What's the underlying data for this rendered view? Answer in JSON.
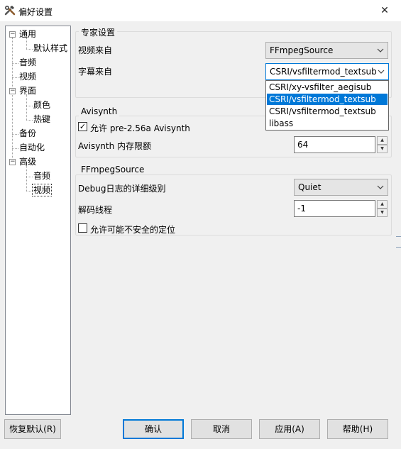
{
  "window": {
    "title": "偏好设置",
    "close_glyph": "✕"
  },
  "tree": {
    "general": "通用",
    "default_styles": "默认样式",
    "audio": "音频",
    "video": "视频",
    "interface": "界面",
    "colors": "颜色",
    "hotkeys": "热键",
    "backup": "备份",
    "automation": "自动化",
    "advanced": "高级",
    "adv_audio": "音频",
    "adv_video": "视频",
    "collapse_glyph": "−"
  },
  "expert": {
    "title": "专家设置",
    "video_source_label": "视频来自",
    "video_source_value": "FFmpegSource",
    "subtitle_source_label": "字幕来自",
    "subtitle_source_value": "CSRI/vsfiltermod_textsub",
    "subtitle_options": [
      "CSRI/xy-vsfilter_aegisub",
      "CSRI/vsfiltermod_textsub",
      "CSRI/vsfiltermod_textsub",
      "libass"
    ],
    "selected_index": 1
  },
  "avisynth": {
    "title": "Avisynth",
    "allow_pre256_label": "允许 pre-2.56a Avisynth",
    "allow_pre256_checked": true,
    "memory_label": "Avisynth 内存限额",
    "memory_value": "64"
  },
  "ffms": {
    "title": "FFmpegSource",
    "debug_label": "Debug日志的详细级别",
    "debug_value": "Quiet",
    "threads_label": "解码线程",
    "threads_value": "-1",
    "unsafe_seek_label": "允许可能不安全的定位",
    "unsafe_seek_checked": false
  },
  "buttons": {
    "restore": "恢复默认(R)",
    "ok": "确认",
    "cancel": "取消",
    "apply": "应用(A)",
    "help": "帮助(H)"
  },
  "icons": {
    "app": "hammer-wrench-icon",
    "dropdown": "chevron-down-icon",
    "check": "✓"
  },
  "colors": {
    "accent": "#0078d7",
    "selection": "#0078d7"
  }
}
